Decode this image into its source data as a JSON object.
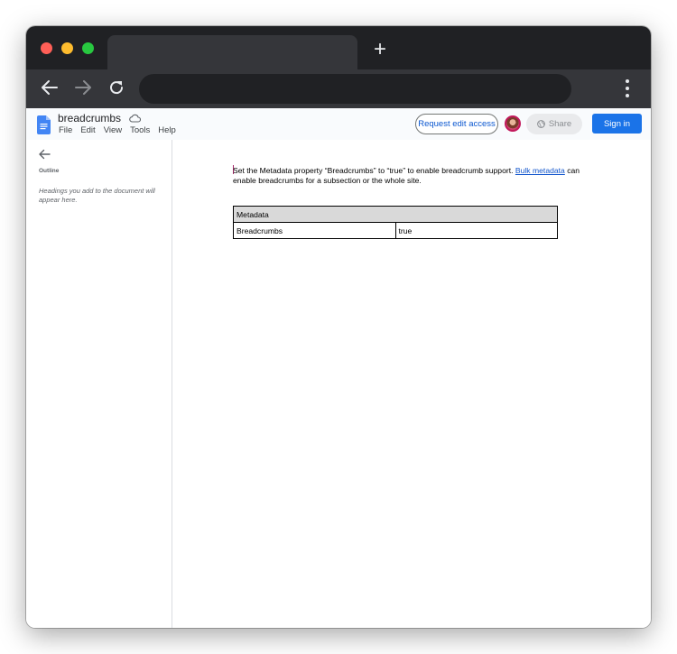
{
  "browser": {
    "new_tab_symbol": "+",
    "icons": {
      "back": "arrow-left-icon",
      "forward": "arrow-right-icon",
      "reload": "reload-icon",
      "menu": "vertical-dots-icon"
    }
  },
  "docs": {
    "title": "breadcrumbs",
    "menu": [
      "File",
      "Edit",
      "View",
      "Tools",
      "Help"
    ],
    "request_edit_label": "Request edit access",
    "share_label": "Share",
    "signin_label": "Sign in",
    "accent_color": "#1a73e8"
  },
  "sidebar": {
    "outline_label": "Outline",
    "hint": "Headings you add to the document will appear here."
  },
  "document": {
    "para_text": "Set the Metadata property “Breadcrumbs” to “true” to enable breadcrumb support.",
    "link_text": "Bulk metadata",
    "para_tail": "can enable breadcrumbs for a subsection or the whole site.",
    "table": {
      "header": "Metadata",
      "rows": [
        [
          "Breadcrumbs",
          "true"
        ]
      ]
    }
  }
}
